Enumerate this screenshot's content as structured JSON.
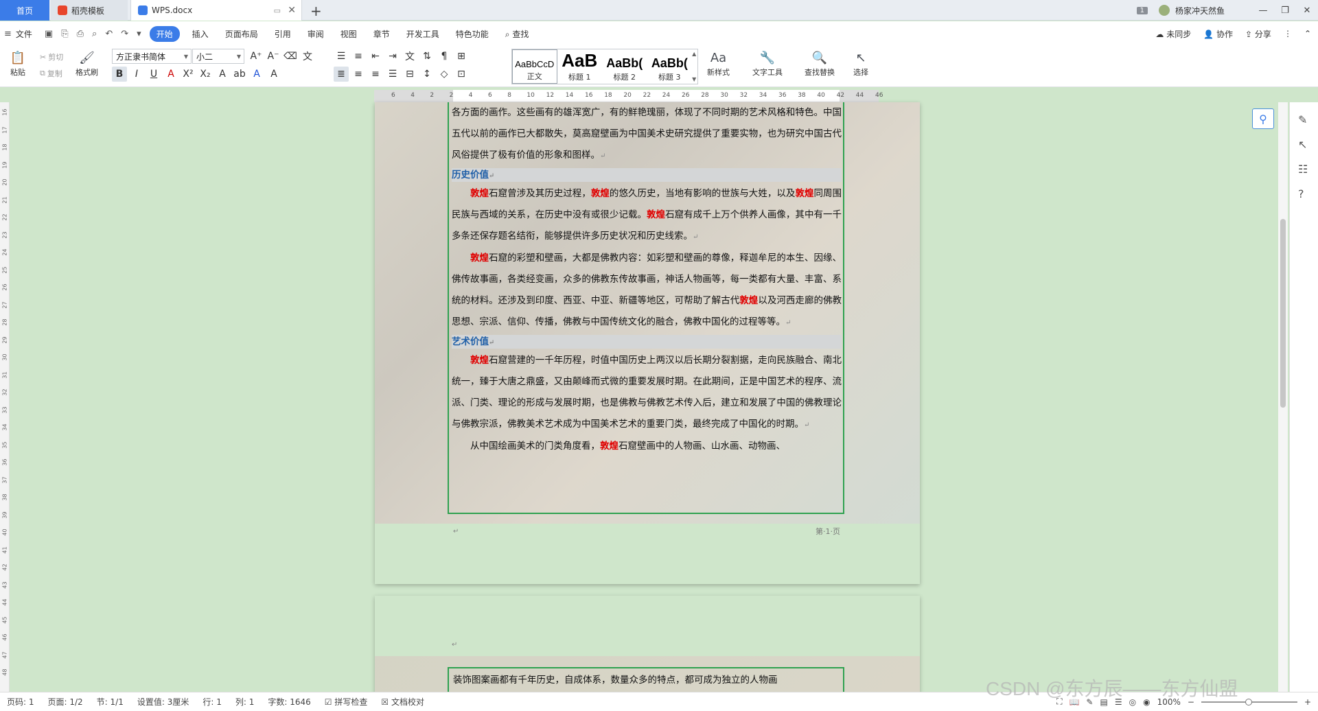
{
  "tabs": {
    "home": "首页",
    "stub": "稻壳模板",
    "doc": "WPS.docx"
  },
  "titlebar": {
    "badge": "1",
    "username": "杨家冲天然鱼"
  },
  "menu": {
    "file": "文件",
    "items": [
      "开始",
      "插入",
      "页面布局",
      "引用",
      "审阅",
      "视图",
      "章节",
      "开发工具",
      "特色功能"
    ],
    "search": "查找",
    "right": [
      "未同步",
      "协作",
      "分享"
    ]
  },
  "ribbon": {
    "paste": "粘贴",
    "cut": "剪切",
    "copy": "复制",
    "format_painter": "格式刷",
    "font_name": "方正隶书简体",
    "font_size": "小二",
    "styles": [
      {
        "preview": "AaBbCcD",
        "label": "正文"
      },
      {
        "preview": "AaB",
        "label": "标题 1"
      },
      {
        "preview": "AaBb(",
        "label": "标题 2"
      },
      {
        "preview": "AaBb(",
        "label": "标题 3"
      }
    ],
    "new_style": "新样式",
    "text_tools": "文字工具",
    "find_replace": "查找替换",
    "select": "选择"
  },
  "ruler": {
    "marks": [
      "6",
      "4",
      "2",
      "2",
      "4",
      "6",
      "8",
      "10",
      "12",
      "14",
      "16",
      "18",
      "20",
      "22",
      "24",
      "26",
      "28",
      "30",
      "32",
      "34",
      "36",
      "38",
      "40",
      "42",
      "44",
      "46"
    ],
    "vmarks": [
      "16",
      "17",
      "18",
      "19",
      "20",
      "21",
      "22",
      "23",
      "24",
      "25",
      "26",
      "27",
      "28",
      "29",
      "30",
      "31",
      "32",
      "33",
      "34",
      "35",
      "36",
      "37",
      "38",
      "39",
      "40",
      "41",
      "42",
      "43",
      "44",
      "45",
      "46",
      "47",
      "48"
    ]
  },
  "document": {
    "para_intro": "各方面的画作。这些画有的雄浑宽广，有的鲜艳瑰丽，体现了不同时期的艺术风格和特色。中国五代以前的画作已大都散失，莫高窟壁画为中国美术史研究提供了重要实物，也为研究中国古代风俗提供了极有价值的形象和图样。",
    "heading1": "历史价值",
    "p1_a": "敦煌",
    "p1_b": "石窟曾涉及其历史过程，",
    "p1_c": "敦煌",
    "p1_d": "的悠久历史，当地有影响的世族与大姓，以及",
    "p1_e": "敦煌",
    "p1_f": "同周围民族与西域的关系，在历史中没有或很少记载。",
    "p1_g": "敦煌",
    "p1_h": "石窟有成千上万个供养人画像，其中有一千多条还保存题名结衔，能够提供许多历史状况和历史线索。",
    "p2_a": "敦煌",
    "p2_b": "石窟的彩塑和壁画，大都是佛教内容：如彩塑和壁画的尊像，释迦牟尼的本生、因缘、佛传故事画，各类经变画，众多的佛教东传故事画，神话人物画等，每一类都有大量、丰富、系统的材料。还涉及到印度、西亚、中亚、新疆等地区，可帮助了解古代",
    "p2_c": "敦煌",
    "p2_d": "以及河西走廊的佛教思想、宗派、信仰、传播，佛教与中国传统文化的融合，佛教中国化的过程等等。",
    "heading2": "艺术价值",
    "p3_a": "敦煌",
    "p3_b": "石窟营建的一千年历程，时值中国历史上两汉以后长期分裂割据，走向民族融合、南北统一，臻于大唐之鼎盛，又由颠峰而式微的重要发展时期。在此期间，正是中国艺术的程序、流派、门类、理论的形成与发展时期，也是佛教与佛教艺术传入后，建立和发展了中国的佛教理论与佛教宗派，佛教美术艺术成为中国美术艺术的重要门类，最终完成了中国化的时期。",
    "p4_a": "从中国绘画美术的门类角度看，",
    "p4_b": "敦煌",
    "p4_c": "石窟壁画中的人物画、山水画、动物画、",
    "page_num": "第·1·页",
    "page2_text": "装饰图案画都有千年历史，自成体系，数量众多的特点，都可成为独立的人物画"
  },
  "status": {
    "page": "页码: 1",
    "pages": "页面: 1/2",
    "section": "节: 1/1",
    "setting": "设置值: 3厘米",
    "row": "行: 1",
    "col": "列: 1",
    "words": "字数: 1646",
    "spell": "拼写检查",
    "proof": "文档校对",
    "zoom": "100%"
  },
  "watermark": "CSDN @东方辰——东方仙盟"
}
